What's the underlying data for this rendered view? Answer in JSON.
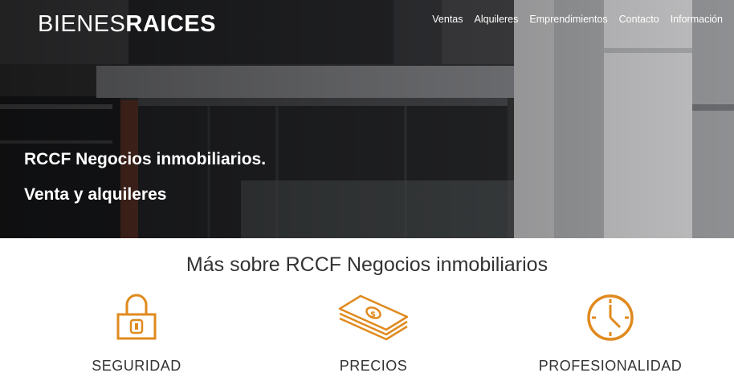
{
  "brand": {
    "light": "BIENES",
    "bold": "RAICES"
  },
  "nav": {
    "items": [
      "Ventas",
      "Alquileres",
      "Emprendimientos",
      "Contacto",
      "Información"
    ]
  },
  "hero": {
    "line1": "RCCF Negocios inmobiliarios.",
    "line2": "Venta y alquileres"
  },
  "section": {
    "title": "Más sobre RCCF Negocios inmobiliarios",
    "features": [
      {
        "label": "SEGURIDAD",
        "icon": "lock-icon"
      },
      {
        "label": "PRECIOS",
        "icon": "money-stack-icon"
      },
      {
        "label": "PROFESIONALIDAD",
        "icon": "clock-icon"
      }
    ]
  },
  "colors": {
    "accent": "#e08a1e",
    "text": "#333333"
  }
}
